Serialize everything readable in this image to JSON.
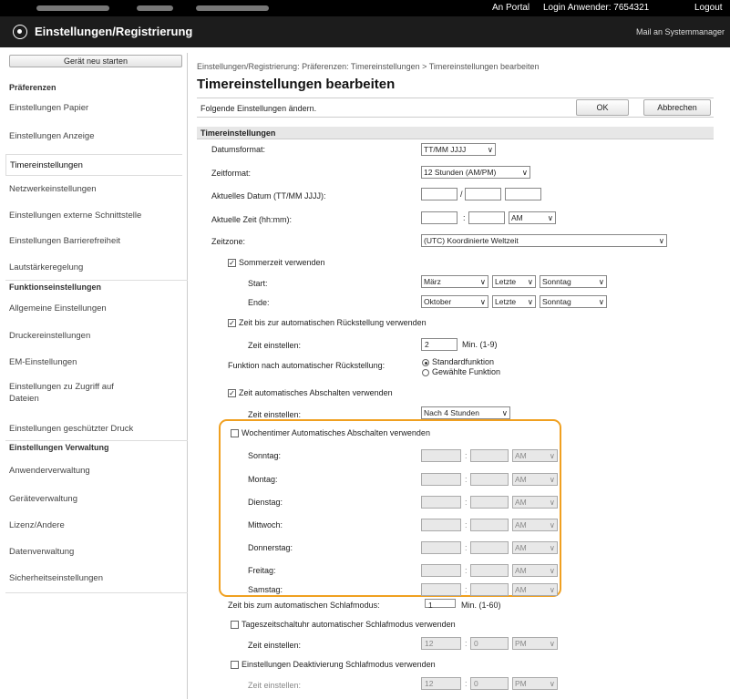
{
  "header": {
    "portal": "An Portal",
    "login": "Login Anwender: 7654321",
    "logout": "Logout",
    "app_title": "Einstellungen/Registrierung",
    "mail": "Mail an Systemmanager"
  },
  "sidebar": {
    "home_button": "Gerät neu starten",
    "sections": [
      {
        "title": "Präferenzen",
        "items": [
          "Einstellungen Papier",
          "Einstellungen Anzeige",
          "Timereinstellungen",
          "Netzwerkeinstellungen",
          "Einstellungen externe Schnittstelle",
          "Einstellungen Barrierefreiheit",
          "Lautstärkeregelung"
        ]
      },
      {
        "title": "Funktionseinstellungen",
        "items": [
          "Allgemeine Einstellungen",
          "Druckereinstellungen",
          "EM-Einstellungen",
          "Einstellungen zu Zugriff auf Dateien",
          "Einstellungen geschützter Druck"
        ]
      },
      {
        "title": "Einstellungen Verwaltung",
        "items": [
          "Anwenderverwaltung",
          "Geräteverwaltung",
          "Lizenz/Andere",
          "Datenverwaltung",
          "Sicherheitseinstellungen"
        ]
      }
    ],
    "active_item": "Timereinstellungen"
  },
  "main": {
    "breadcrumb": "Einstellungen/Registrierung: Präferenzen: Timereinstellungen > Timereinstellungen bearbeiten",
    "title": "Timereinstellungen bearbeiten",
    "instruction": "Folgende Einstellungen ändern.",
    "ok_button": "OK",
    "cancel_button": "Abbrechen",
    "section_title": "Timereinstellungen",
    "date_format_label": "Datumsformat:",
    "date_format_value": "TT/MM JJJJ",
    "time_format_label": "Zeitformat:",
    "time_format_value": "12 Stunden (AM/PM)",
    "current_date_label": "Aktuelles Datum (TT/MM JJJJ):",
    "date_separator": "/",
    "current_time_label": "Aktuelle Zeit (hh:mm):",
    "time_separator": ":",
    "ampm_value": "AM",
    "timezone_label": "Zeitzone:",
    "timezone_value": "(UTC) Koordinierte Weltzeit",
    "dst_label": "Sommerzeit verwenden",
    "dst_checked": true,
    "start_label": "Start:",
    "start_month": "März",
    "start_week": "Letzte",
    "start_day": "Sonntag",
    "end_label": "Ende:",
    "end_month": "Oktober",
    "end_week": "Letzte",
    "end_day": "Sonntag",
    "auto_reset_label": "Zeit bis zur automatischen Rückstellung verwenden",
    "auto_reset_checked": true,
    "auto_reset_time_label": "Zeit einstellen:",
    "auto_reset_time_value": "2",
    "auto_reset_unit": "Min. (1-9)",
    "after_reset_label": "Funktion nach automatischer Rückstellung:",
    "after_reset_option1": "Standardfunktion",
    "after_reset_option2": "Gewählte Funktion",
    "auto_off_label": "Zeit automatisches Abschalten verwenden",
    "auto_off_checked": true,
    "auto_off_time_label": "Zeit einstellen:",
    "auto_off_time_value": "Nach 4 Stunden",
    "weekly_label": "Wochentimer Automatisches Abschalten verwenden",
    "weekly_checked": false,
    "days": [
      "Sonntag:",
      "Montag:",
      "Dienstag:",
      "Mittwoch:",
      "Donnerstag:",
      "Freitag:",
      "Samstag:"
    ],
    "day_ampm": "AM",
    "sleep_label": "Zeit bis zum automatischen Schlafmodus:",
    "sleep_value": "1",
    "sleep_unit": "Min. (1-60)",
    "daily_sleep_label": "Tageszeitschaltuhr automatischer Schlafmodus verwenden",
    "daily_sleep_time_label": "Zeit einstellen:",
    "daily_sleep_hour": "12",
    "daily_sleep_min": "0",
    "daily_sleep_ampm": "PM",
    "deactivate_sleep_label": "Einstellungen Deaktivierung Schlafmodus verwenden",
    "deactivate_time_label": "Zeit einstellen:",
    "deactivate_hour": "12",
    "deactivate_min": "0",
    "deactivate_ampm": "PM",
    "highlight_color": "#f0a020"
  }
}
